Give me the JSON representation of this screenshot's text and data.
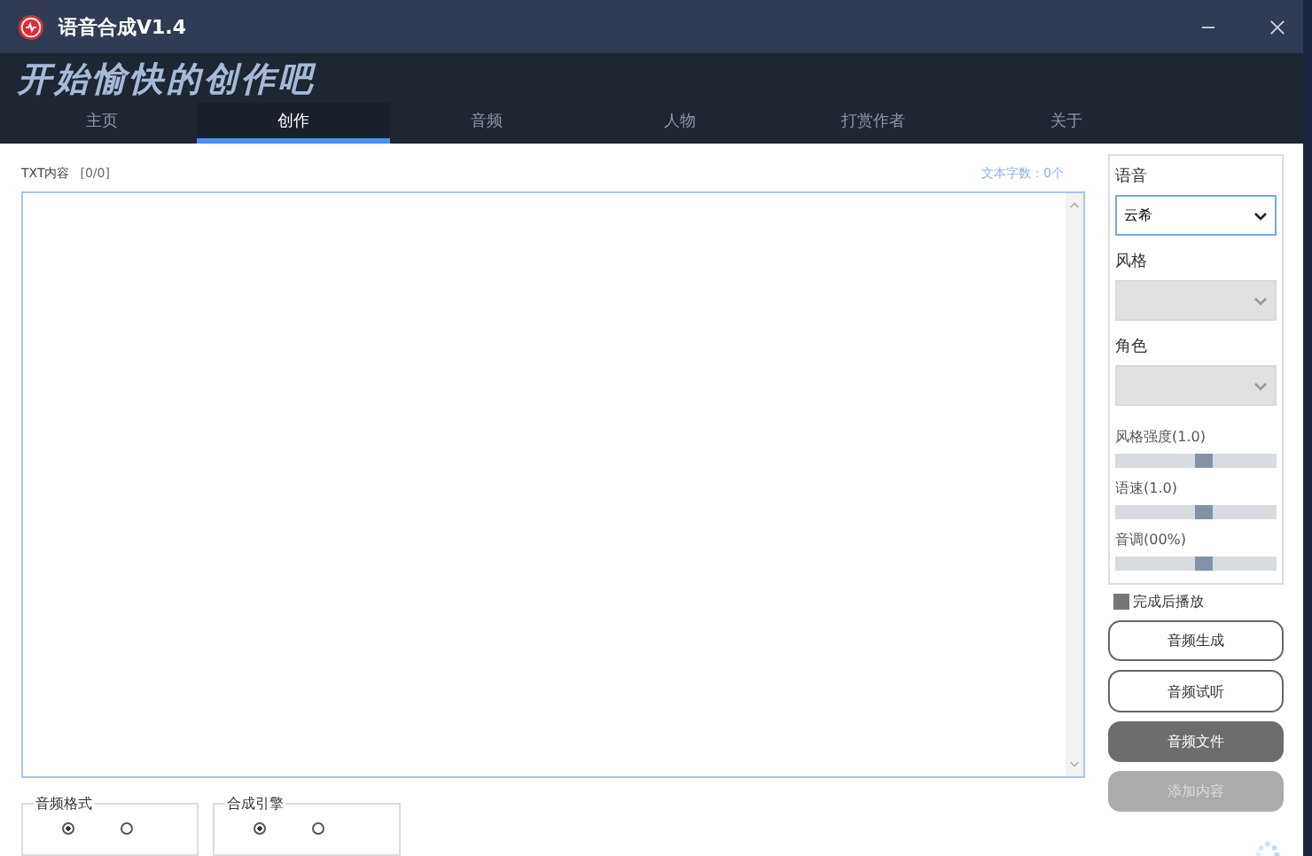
{
  "window": {
    "title": "语音合成V1.4"
  },
  "slogan": "开始愉快的创作吧",
  "tabs": [
    {
      "label": "主页",
      "selected": false
    },
    {
      "label": "创作",
      "selected": true
    },
    {
      "label": "音频",
      "selected": false
    },
    {
      "label": "人物",
      "selected": false
    },
    {
      "label": "打赏作者",
      "selected": false
    },
    {
      "label": "关于",
      "selected": false
    }
  ],
  "editor": {
    "label": "TXT内容",
    "counter": "[0/0]",
    "char_count": "文本字数：0个"
  },
  "settings": {
    "voice": {
      "label": "语音",
      "value": "云希",
      "disabled": false
    },
    "style": {
      "label": "风格",
      "disabled": true
    },
    "role": {
      "label": "角色",
      "disabled": true
    },
    "sliders": [
      {
        "label": "风格强度(1.0)",
        "level": 0.55
      },
      {
        "label": "语速(1.0)",
        "level": 0.55
      },
      {
        "label": "音调(00%)",
        "level": 0.55
      }
    ],
    "autoplay": {
      "label": "完成后播放",
      "checked": true
    }
  },
  "buttons": [
    {
      "label": "音频生成",
      "kind": "outline",
      "disabled": false
    },
    {
      "label": "音频试听",
      "kind": "outline",
      "disabled": false
    },
    {
      "label": "音频文件",
      "kind": "filled",
      "disabled": false
    },
    {
      "label": "添加内容",
      "kind": "filled",
      "disabled": true
    }
  ],
  "groups": [
    {
      "title": "音频格式",
      "radios": [
        {
          "selected": true
        },
        {
          "selected": false
        }
      ]
    },
    {
      "title": "合成引擎",
      "radios": [
        {
          "selected": true
        },
        {
          "selected": false
        }
      ]
    }
  ]
}
